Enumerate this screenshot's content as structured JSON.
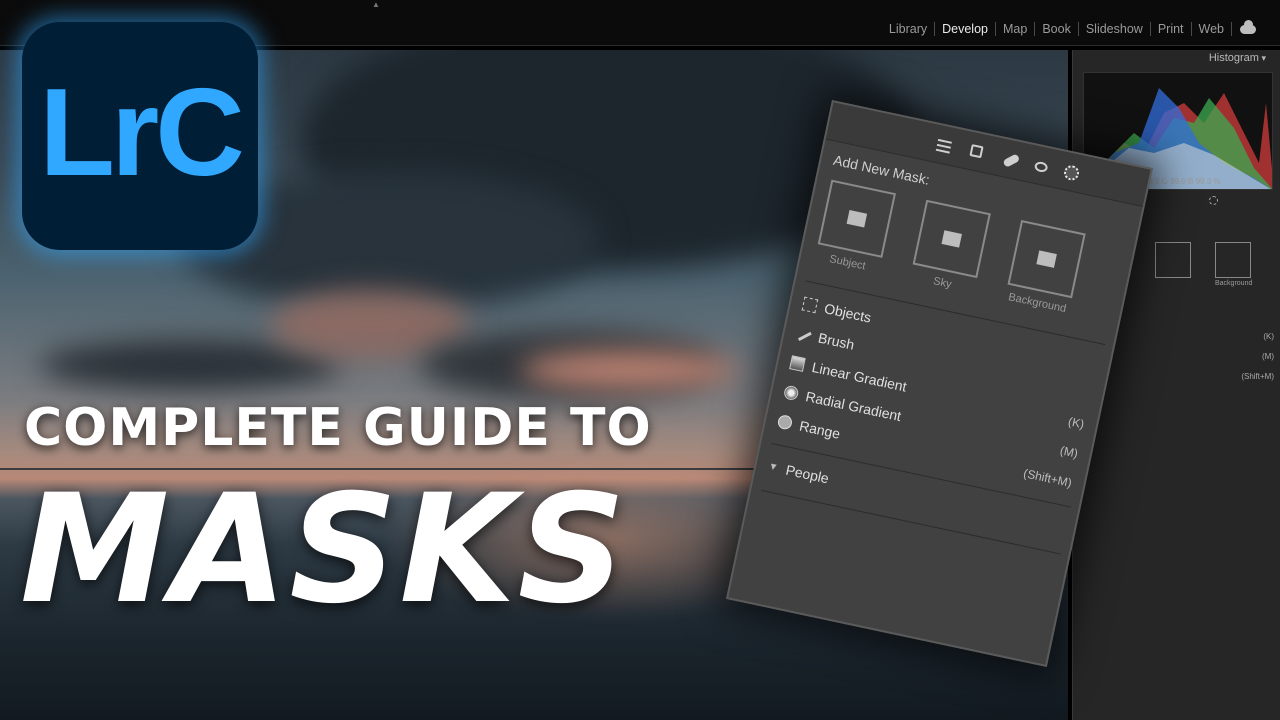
{
  "modules": [
    "Library",
    "Develop",
    "Map",
    "Book",
    "Slideshow",
    "Print",
    "Web"
  ],
  "active_module": "Develop",
  "logo_text": "LrC",
  "headline": {
    "line1": "COMPLETE GUIDE TO",
    "line2": "MASKS"
  },
  "right_panel": {
    "histogram_title": "Histogram",
    "readout": "98.9  G  99.0  B  99.3 %",
    "mini_tile_labels": [
      "Background"
    ],
    "mini_shortcuts": [
      "(K)",
      "(M)",
      "(Shift+M)"
    ]
  },
  "mask_panel": {
    "add_label": "Add New Mask:",
    "tiles": [
      {
        "label": "Subject"
      },
      {
        "label": "Sky"
      },
      {
        "label": "Background"
      }
    ],
    "items": [
      {
        "label": "Objects",
        "shortcut": ""
      },
      {
        "label": "Brush",
        "shortcut": ""
      },
      {
        "label": "Linear Gradient",
        "shortcut": "(K)"
      },
      {
        "label": "Radial Gradient",
        "shortcut": "(M)"
      },
      {
        "label": "Range",
        "shortcut": "(Shift+M)"
      }
    ],
    "section": "People"
  },
  "colors": {
    "logo_bg": "#001e36",
    "logo_accent": "#31a8ff",
    "panel_bg": "#414141"
  }
}
